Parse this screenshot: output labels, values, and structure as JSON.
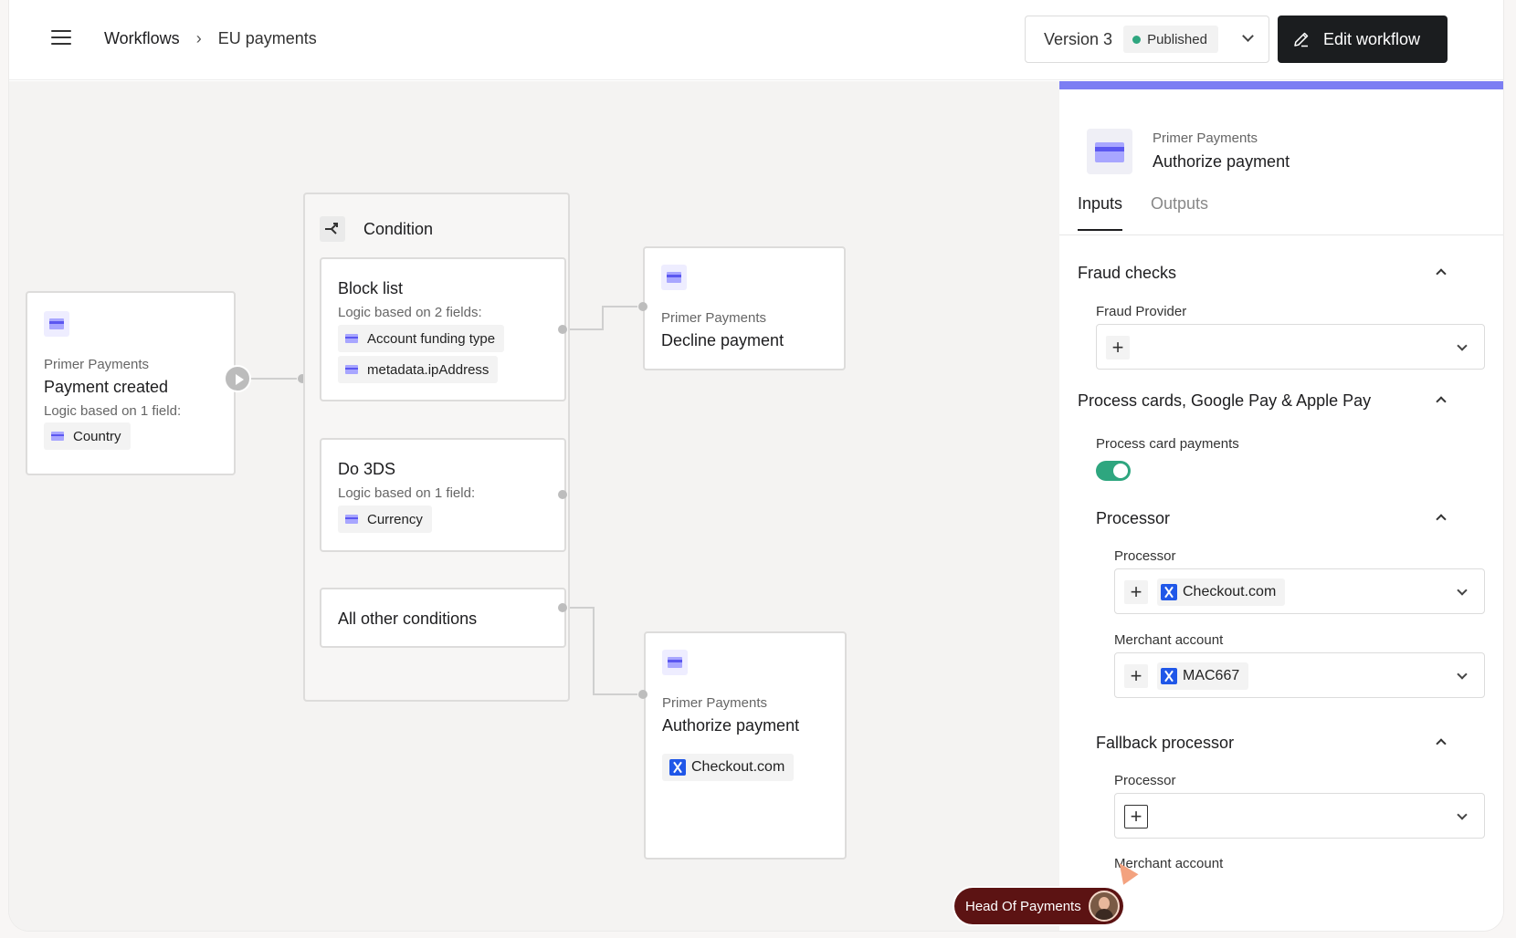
{
  "header": {
    "breadcrumb": {
      "root": "Workflows",
      "current": "EU payments"
    },
    "version": {
      "label": "Version 3",
      "status": "Published",
      "status_color": "#2ea67f"
    },
    "edit_button": "Edit workflow"
  },
  "canvas": {
    "trigger": {
      "provider": "Primer Payments",
      "title": "Payment created",
      "logic": "Logic based on 1 field:",
      "fields": [
        "Country"
      ]
    },
    "condition": {
      "title": "Condition",
      "branches": [
        {
          "title": "Block list",
          "logic": "Logic based on 2 fields:",
          "fields": [
            "Account funding type",
            "metadata.ipAddress"
          ]
        },
        {
          "title": "Do 3DS",
          "logic": "Logic based on 1 field:",
          "fields": [
            "Currency"
          ]
        },
        {
          "title": "All other conditions"
        }
      ]
    },
    "decline_action": {
      "provider": "Primer Payments",
      "title": "Decline payment"
    },
    "authorize_action": {
      "provider": "Primer Payments",
      "title": "Authorize payment",
      "processor": "Checkout.com"
    }
  },
  "panel": {
    "provider": "Primer Payments",
    "title": "Authorize payment",
    "tabs": [
      "Inputs",
      "Outputs"
    ],
    "fraud": {
      "title": "Fraud checks",
      "provider_label": "Fraud Provider"
    },
    "process": {
      "title": "Process cards, Google Pay & Apple Pay",
      "toggle_label": "Process card payments",
      "processor_section": "Processor",
      "processor_label": "Processor",
      "processor_value": "Checkout.com",
      "merchant_label": "Merchant account",
      "merchant_value": "MAC667",
      "fallback_section": "Fallback processor",
      "fallback_processor_label": "Processor",
      "fallback_merchant_label": "Merchant account"
    }
  },
  "presence": {
    "name": "Head Of Payments"
  },
  "colors": {
    "accent_bar": "#7c7ef3",
    "primary_button": "#1b1d1f",
    "toggle_on": "#2ea67f",
    "presence_bg": "#5c1313"
  }
}
